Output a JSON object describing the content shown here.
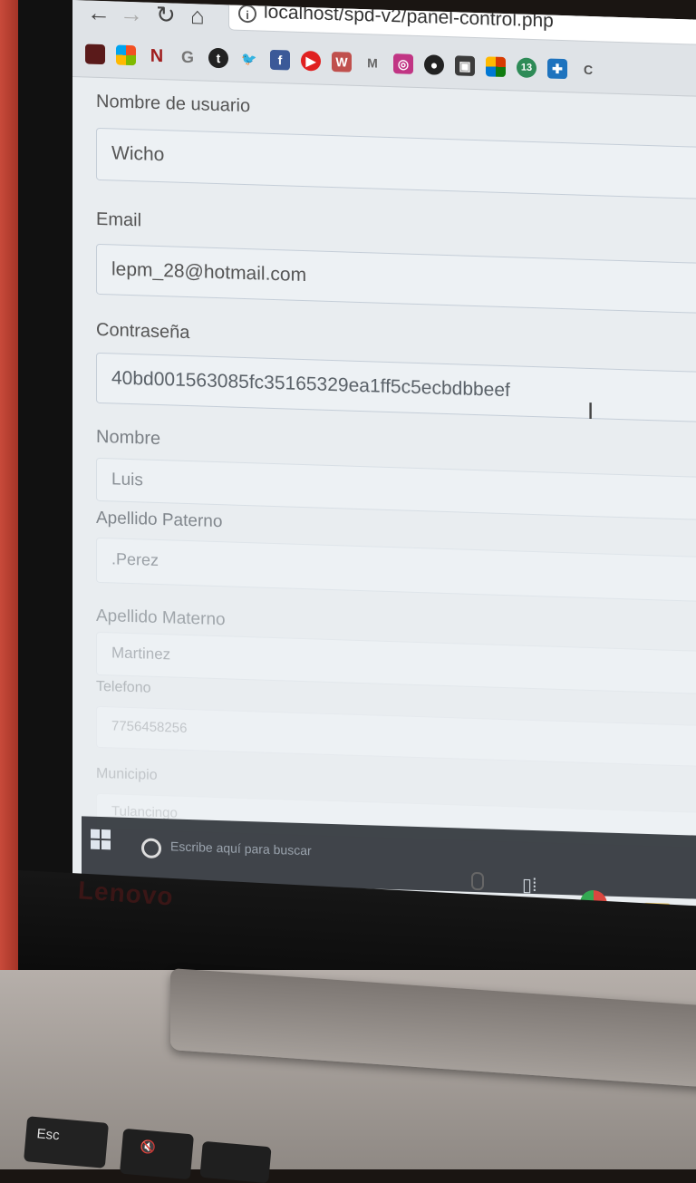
{
  "browser": {
    "url": "localhost/spd-v2/panel-control.php",
    "bookmarks": [
      "N",
      "Microsoft",
      "N",
      "G",
      "t",
      "Twitter",
      "Facebook",
      "YouTube",
      "W",
      "M",
      "Instagram",
      "GitHub",
      "App",
      "Office",
      "13",
      "Ext",
      "C"
    ]
  },
  "form": {
    "fields": [
      {
        "label": "Nombre de usuario",
        "value": "Wicho"
      },
      {
        "label": "Email",
        "value": "lepm_28@hotmail.com"
      },
      {
        "label": "Contraseña",
        "value": "40bd001563085fc35165329ea1ff5c5ecbdbbeef"
      },
      {
        "label": "Nombre",
        "value": "Luis"
      },
      {
        "label": "Apellido Paterno",
        "value": ".Perez"
      },
      {
        "label": "Apellido Materno",
        "value": "Martinez"
      },
      {
        "label": "Telefono",
        "value": "7756458256"
      },
      {
        "label": "Municipio",
        "value": "Tulancingo"
      }
    ]
  },
  "taskbar": {
    "search_placeholder": "Escribe aquí para buscar"
  },
  "hardware": {
    "brand": "Lenovo",
    "esc_key": "Esc"
  }
}
